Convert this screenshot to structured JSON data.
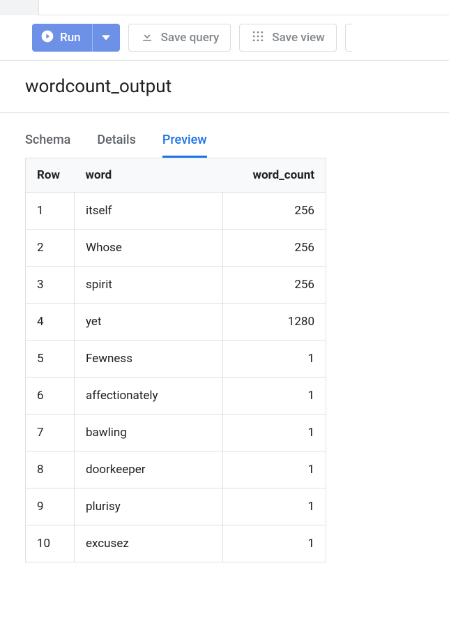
{
  "toolbar": {
    "run_label": "Run",
    "save_query_label": "Save query",
    "save_view_label": "Save view"
  },
  "page_title": "wordcount_output",
  "tabs": {
    "schema": "Schema",
    "details": "Details",
    "preview": "Preview"
  },
  "table": {
    "headers": {
      "row": "Row",
      "word": "word",
      "word_count": "word_count"
    },
    "rows": [
      {
        "n": "1",
        "word": "itself",
        "count": "256"
      },
      {
        "n": "2",
        "word": "Whose",
        "count": "256"
      },
      {
        "n": "3",
        "word": "spirit",
        "count": "256"
      },
      {
        "n": "4",
        "word": "yet",
        "count": "1280"
      },
      {
        "n": "5",
        "word": "Fewness",
        "count": "1"
      },
      {
        "n": "6",
        "word": "affectionately",
        "count": "1"
      },
      {
        "n": "7",
        "word": "bawling",
        "count": "1"
      },
      {
        "n": "8",
        "word": "doorkeeper",
        "count": "1"
      },
      {
        "n": "9",
        "word": "plurisy",
        "count": "1"
      },
      {
        "n": "10",
        "word": "excusez",
        "count": "1"
      }
    ]
  }
}
